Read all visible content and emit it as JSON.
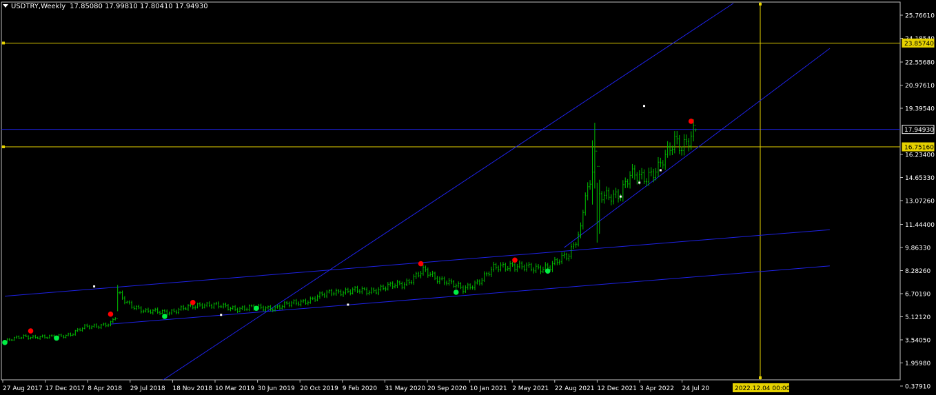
{
  "header": {
    "symbol": "USDTRY,Weekly",
    "ohlc": "17.85080 17.99810 17.80410 17.94930"
  },
  "colors": {
    "background": "#000000",
    "axis": "#c0c0c0",
    "text": "#ffffff",
    "candle": "#00c000",
    "trendline": "#1e22e6",
    "hline_yellow": "#e6d200",
    "hline_blue": "#1e22e6",
    "fractal_up": "#ff0000",
    "fractal_down": "#00ee44",
    "marker": "#ffffff"
  },
  "chart_data": {
    "type": "candlestick",
    "title": "USDTRY,Weekly",
    "timeframe": "Weekly",
    "last_ohlc": {
      "open": 17.8508,
      "high": 17.9981,
      "low": 17.8041,
      "close": 17.9493
    },
    "ylim": [
      0.3,
      26.6
    ],
    "y_ticks": [
      "25.76610",
      "24.18540",
      "22.55680",
      "20.97610",
      "19.39540",
      "16.23400",
      "14.65330",
      "13.07260",
      "11.44400",
      "9.86330",
      "8.28260",
      "6.70190",
      "5.12120",
      "3.54050",
      "1.95980",
      "0.37910"
    ],
    "x_ticks": [
      "27 Aug 2017",
      "17 Dec 2017",
      "8 Apr 2018",
      "29 Jul 2018",
      "18 Nov 2018",
      "10 Mar 2019",
      "30 Jun 2019",
      "20 Oct 2019",
      "9 Feb 2020",
      "31 May 2020",
      "20 Sep 2020",
      "10 Jan 2021",
      "2 May 2021",
      "22 Aug 2021",
      "12 Dec 2021",
      "3 Apr 2022",
      "24 Jul 20"
    ],
    "price_labels": [
      {
        "text": "23.85740",
        "value": 23.8574,
        "kind": "yellow"
      },
      {
        "text": "17.94930",
        "value": 17.9493,
        "kind": "current"
      },
      {
        "text": "16.75160",
        "value": 16.7516,
        "kind": "yellow"
      }
    ],
    "horizontal_lines": [
      {
        "value": 23.8574,
        "color": "yellow"
      },
      {
        "value": 17.9493,
        "color": "blue"
      },
      {
        "value": 16.7516,
        "color": "yellow"
      }
    ],
    "vertical_line": {
      "label": "2022.12.04 00:00"
    },
    "anchors": [
      {
        "week": 0,
        "close": 3.44
      },
      {
        "week": 8,
        "close": 3.78
      },
      {
        "week": 18,
        "close": 3.7
      },
      {
        "week": 28,
        "close": 3.92
      },
      {
        "week": 34,
        "close": 4.4
      },
      {
        "week": 45,
        "close": 4.65
      },
      {
        "week": 47,
        "close": 5.05
      },
      {
        "week": 48,
        "close": 6.7
      },
      {
        "week": 52,
        "close": 6.1
      },
      {
        "week": 60,
        "close": 5.45
      },
      {
        "week": 72,
        "close": 5.5
      },
      {
        "week": 84,
        "close": 6.0
      },
      {
        "week": 98,
        "close": 5.7
      },
      {
        "week": 115,
        "close": 5.75
      },
      {
        "week": 130,
        "close": 6.3
      },
      {
        "week": 140,
        "close": 6.85
      },
      {
        "week": 155,
        "close": 6.9
      },
      {
        "week": 170,
        "close": 7.4
      },
      {
        "week": 178,
        "close": 8.25
      },
      {
        "week": 183,
        "close": 7.8
      },
      {
        "week": 188,
        "close": 7.6
      },
      {
        "week": 195,
        "close": 6.95
      },
      {
        "week": 200,
        "close": 7.4
      },
      {
        "week": 208,
        "close": 8.4
      },
      {
        "week": 216,
        "close": 8.7
      },
      {
        "week": 225,
        "close": 8.35
      },
      {
        "week": 232,
        "close": 8.65
      },
      {
        "week": 240,
        "close": 9.3
      },
      {
        "week": 245,
        "close": 11.2
      },
      {
        "week": 247,
        "close": 13.8
      },
      {
        "week": 249,
        "close": 13.9
      },
      {
        "week": 251,
        "close": 16.5
      },
      {
        "week": 253,
        "close": 13.3
      },
      {
        "week": 255,
        "close": 13.4
      },
      {
        "week": 262,
        "close": 13.6
      },
      {
        "week": 266,
        "close": 14.7
      },
      {
        "week": 272,
        "close": 14.7
      },
      {
        "week": 278,
        "close": 15.3
      },
      {
        "week": 282,
        "close": 16.2
      },
      {
        "week": 285,
        "close": 17.2
      },
      {
        "week": 288,
        "close": 16.9
      },
      {
        "week": 292,
        "close": 17.5
      },
      {
        "week": 294,
        "close": 17.95
      }
    ],
    "spikes": [
      {
        "week": 48,
        "high": 7.3,
        "low": 5.5
      },
      {
        "week": 250,
        "high": 17.2,
        "low": 12.8
      },
      {
        "week": 251,
        "high": 18.4,
        "low": 13.9
      },
      {
        "week": 252,
        "high": 14.3,
        "low": 10.2
      },
      {
        "week": 253,
        "high": 14.5,
        "low": 10.8
      }
    ],
    "fractals_up": [
      {
        "week": 11,
        "value": 4.15
      },
      {
        "week": 45,
        "value": 5.3
      },
      {
        "week": 80,
        "value": 6.1
      },
      {
        "week": 177,
        "value": 8.75
      },
      {
        "week": 217,
        "value": 9.0
      },
      {
        "week": 292,
        "value": 18.5
      }
    ],
    "fractals_down": [
      {
        "week": 0,
        "value": 3.36
      },
      {
        "week": 22,
        "value": 3.66
      },
      {
        "week": 68,
        "value": 5.15
      },
      {
        "week": 107,
        "value": 5.7
      },
      {
        "week": 192,
        "value": 6.8
      },
      {
        "week": 231,
        "value": 8.25
      }
    ],
    "channel_lines": [
      {
        "from": {
          "week": 0,
          "value": 6.53
        },
        "to": {
          "week": 351,
          "value": 11.08
        }
      },
      {
        "from": {
          "week": 45,
          "value": 4.62
        },
        "to": {
          "week": 351,
          "value": 8.6
        }
      },
      {
        "from": {
          "week": 61,
          "value": 0.12
        },
        "to": {
          "week": 310,
          "value": 26.58
        }
      },
      {
        "from": {
          "week": 238,
          "value": 9.86
        },
        "to": {
          "week": 351,
          "value": 23.49
        }
      }
    ],
    "markers": [
      {
        "week": 38,
        "value": 7.2
      },
      {
        "week": 92,
        "value": 5.25
      },
      {
        "week": 146,
        "value": 5.95
      },
      {
        "week": 272,
        "value": 19.55
      },
      {
        "week": 262,
        "value": 13.35
      },
      {
        "week": 270,
        "value": 14.3
      },
      {
        "week": 279,
        "value": 15.15
      }
    ]
  }
}
